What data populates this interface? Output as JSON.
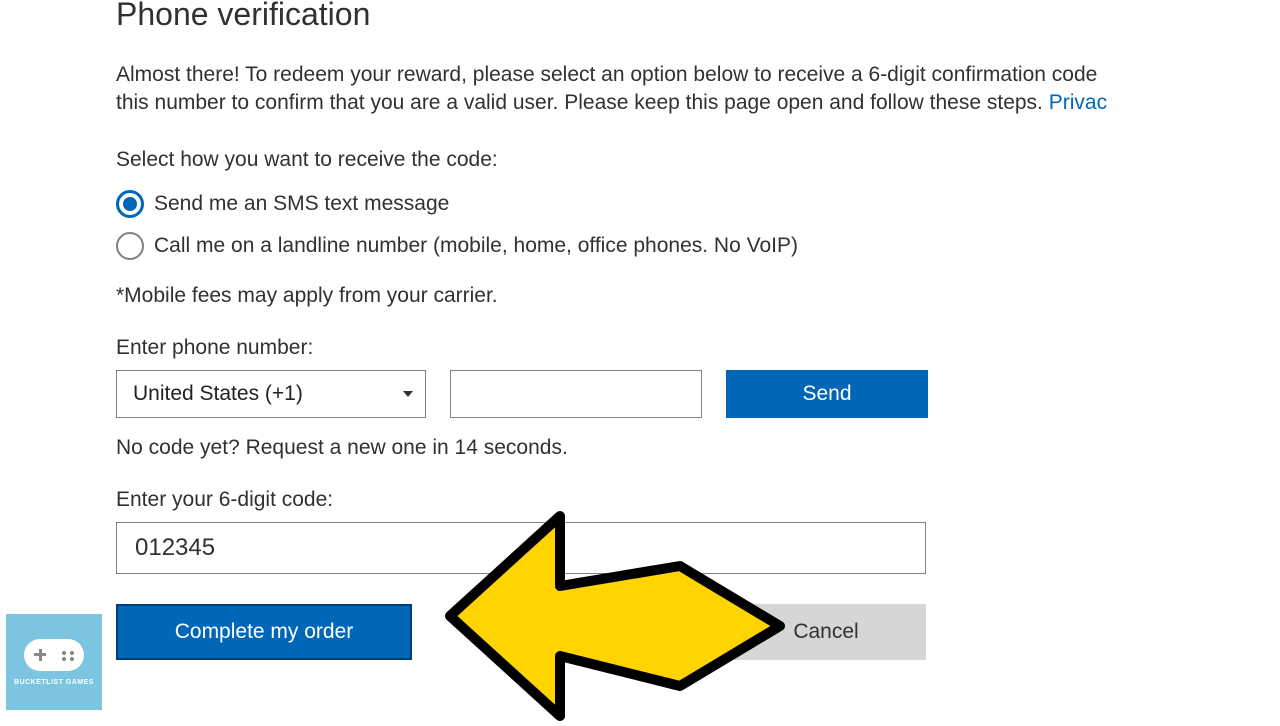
{
  "title": "Phone verification",
  "intro_line1": "Almost there! To redeem your reward, please select an option below to receive a 6-digit confirmation code",
  "intro_line2_a": "this number to confirm that you are a valid user. Please keep this page open and follow these steps. ",
  "privacy_link": "Privac",
  "select_label": "Select how you want to receive the code:",
  "options": {
    "sms": "Send me an SMS text message",
    "call": "Call me on a landline number (mobile, home, office phones. No VoIP)"
  },
  "fees_note": "*Mobile fees may apply from your carrier.",
  "phone_label": "Enter phone number:",
  "country_selected": "United States (+1)",
  "phone_value": "",
  "send_label": "Send",
  "countdown_text": "No code yet? Request a new one in 14 seconds.",
  "code_label": "Enter your 6-digit code:",
  "code_value": "012345",
  "complete_label": "Complete my order",
  "cancel_label": "Cancel",
  "logo_text": "BUCKETLIST GAMES"
}
